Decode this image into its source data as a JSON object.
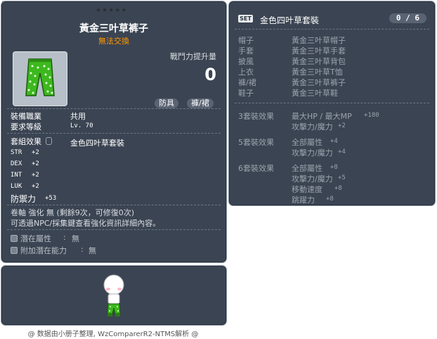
{
  "item_code": "01062150",
  "item": {
    "stars": "★★★★★",
    "name": "黃金三叶草裤子",
    "untradeable": "無法交換",
    "power_label": "戰鬥力提升量",
    "power_value": "0",
    "tags": [
      "防具",
      "褲/裙"
    ],
    "req_job_label": "裝備職業",
    "req_job_value": "共用",
    "req_level_label": "要求等級",
    "req_level_value": "Lv. 70",
    "set_label": "套組效果",
    "set_value": "金色四叶草套裝",
    "stats": [
      {
        "name": "STR",
        "value": "+2"
      },
      {
        "name": "DEX",
        "value": "+2"
      },
      {
        "name": "INT",
        "value": "+2"
      },
      {
        "name": "LUK",
        "value": "+2"
      }
    ],
    "defense_label": "防禦力",
    "defense_value": "+53",
    "scroll_line": "卷軸 強化 無 (剩餘9次，可修復0次)",
    "npc_line": "可透過NPC/採集鍵查看強化資訊詳細內容。",
    "potential_label": "潛在屬性",
    "potential_value": "無",
    "bonus_potential_label": "附加潛在能力",
    "bonus_potential_value": "無"
  },
  "set_panel": {
    "badge": "SET",
    "title": "金色四叶草套裝",
    "count": "0 / 6",
    "pieces": [
      {
        "slot": "帽子",
        "name": "黃金三叶草帽子"
      },
      {
        "slot": "手套",
        "name": "黃金三叶草手套"
      },
      {
        "slot": "披風",
        "name": "黃金三叶草背包"
      },
      {
        "slot": "上衣",
        "name": "黃金三叶草T恤"
      },
      {
        "slot": "褲/裙",
        "name": "黃金三叶草裤子"
      },
      {
        "slot": "鞋子",
        "name": "黃金三叶草鞋"
      }
    ],
    "effects": [
      {
        "label": "3套裝效果",
        "lines": [
          {
            "text": "最大HP / 最大MP",
            "value": "+180"
          },
          {
            "text": "攻擊力/魔力",
            "value": "+2"
          }
        ]
      },
      {
        "label": "5套裝效果",
        "lines": [
          {
            "text": "全部屬性",
            "value": "+4"
          },
          {
            "text": "攻擊力/魔力",
            "value": "+4"
          }
        ]
      },
      {
        "label": "6套裝效果",
        "lines": [
          {
            "text": "全部屬性",
            "value": "+8"
          },
          {
            "text": "攻擊力/魔力",
            "value": "+5"
          },
          {
            "text": "移動速度",
            "value": "+8"
          },
          {
            "text": "跳躍力",
            "value": "+8"
          }
        ]
      }
    ]
  },
  "footer": "@ 数据由小册子整理, WzComparerR2-NTMS解析 @",
  "colors": {
    "panel_bg": "#3b4452",
    "untradeable": "#ff9900",
    "dim_text": "#9aa3ad",
    "pants_green": "#3db81e"
  },
  "icons": {
    "pants": "green-polka-dot-pants",
    "character": "character-preview"
  }
}
